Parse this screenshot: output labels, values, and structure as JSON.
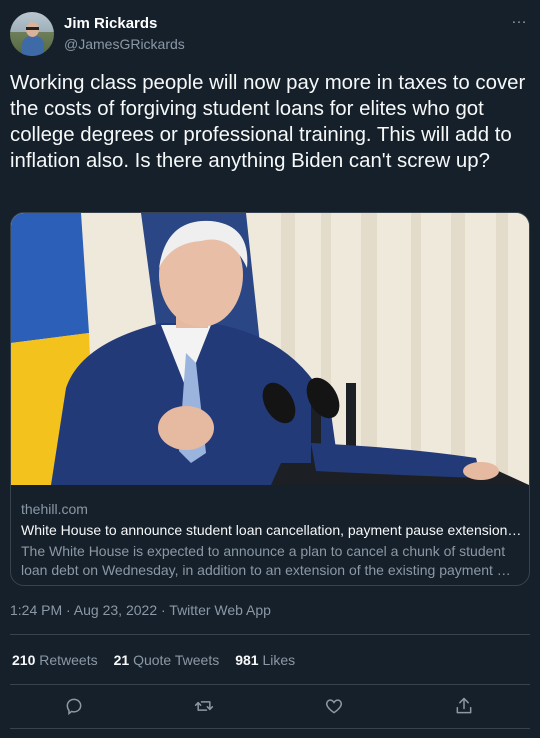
{
  "author": {
    "name": "Jim Rickards",
    "handle": "@JamesGRickards"
  },
  "more_icon": "…",
  "tweet_text": "Working class people will now pay more in taxes to cover the costs of forgiving student loans for elites who got college degrees or professional training. This will add to inflation also. Is there anything Biden can't screw up?",
  "card": {
    "domain": "thehill.com",
    "title": "White House to announce student loan cancellation, payment pause extension…",
    "description": "The White House is expected to announce a plan to cancel a chunk of student loan debt on Wednesday, in addition to an extension of the existing payment …"
  },
  "meta": "1:24 PM · Aug 23, 2022 · Twitter Web App",
  "stats": {
    "retweets_count": "210",
    "retweets_label": "Retweets",
    "quotes_count": "21",
    "quotes_label": "Quote Tweets",
    "likes_count": "981",
    "likes_label": "Likes"
  },
  "actions": [
    "reply-icon",
    "retweet-icon",
    "like-icon",
    "share-icon"
  ],
  "colors": {
    "background": "#15202b",
    "text": "#f7f9f9",
    "secondary": "#8b98a5",
    "border": "#38444d"
  }
}
